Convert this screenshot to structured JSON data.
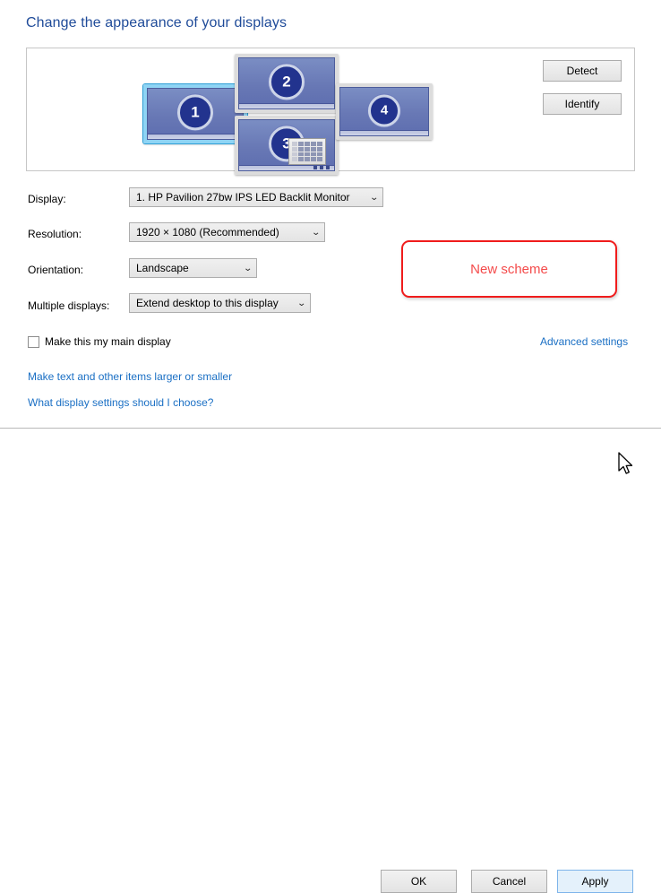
{
  "page": {
    "title": "Change the appearance of your displays"
  },
  "preview": {
    "monitors": [
      {
        "id": "1",
        "label": "1",
        "selected": true,
        "has_keyboard_glyph": false
      },
      {
        "id": "2",
        "label": "2",
        "selected": false,
        "has_keyboard_glyph": false
      },
      {
        "id": "3",
        "label": "3",
        "selected": false,
        "has_keyboard_glyph": true
      },
      {
        "id": "4",
        "label": "4",
        "selected": false,
        "has_keyboard_glyph": false
      }
    ],
    "detect_label": "Detect",
    "identify_label": "Identify"
  },
  "form": {
    "display": {
      "label": "Display:",
      "value": "1. HP Pavilion 27bw IPS LED Backlit Monitor",
      "chevron": "⌄"
    },
    "resolution": {
      "label": "Resolution:",
      "value": "1920 × 1080 (Recommended)",
      "chevron": "⌄"
    },
    "orientation": {
      "label": "Orientation:",
      "value": "Landscape",
      "chevron": "⌄"
    },
    "multiple_displays": {
      "label": "Multiple displays:",
      "value": "Extend desktop to this display",
      "chevron": "⌄"
    },
    "main_display_checkbox": {
      "label": "Make this my main display",
      "checked": false
    },
    "advanced_settings_link": "Advanced settings"
  },
  "annotation": {
    "text": "New scheme",
    "border_color": "#f01c1c",
    "text_color": "#f44b4b"
  },
  "links": {
    "make_text_larger": "Make text and other items larger or smaller",
    "what_display_settings": "What display settings should I choose?"
  },
  "footer": {
    "ok_label": "OK",
    "cancel_label": "Cancel",
    "apply_label": "Apply",
    "apply_hovered": true
  },
  "colors": {
    "title_blue": "#1f4b99",
    "link_blue": "#1a6fc4",
    "monitor_fill": "#6878b5",
    "monitor_badge": "#22338e",
    "selection_highlight": "#8fd4f4",
    "apply_hover_fill": "#e4f1fb"
  }
}
